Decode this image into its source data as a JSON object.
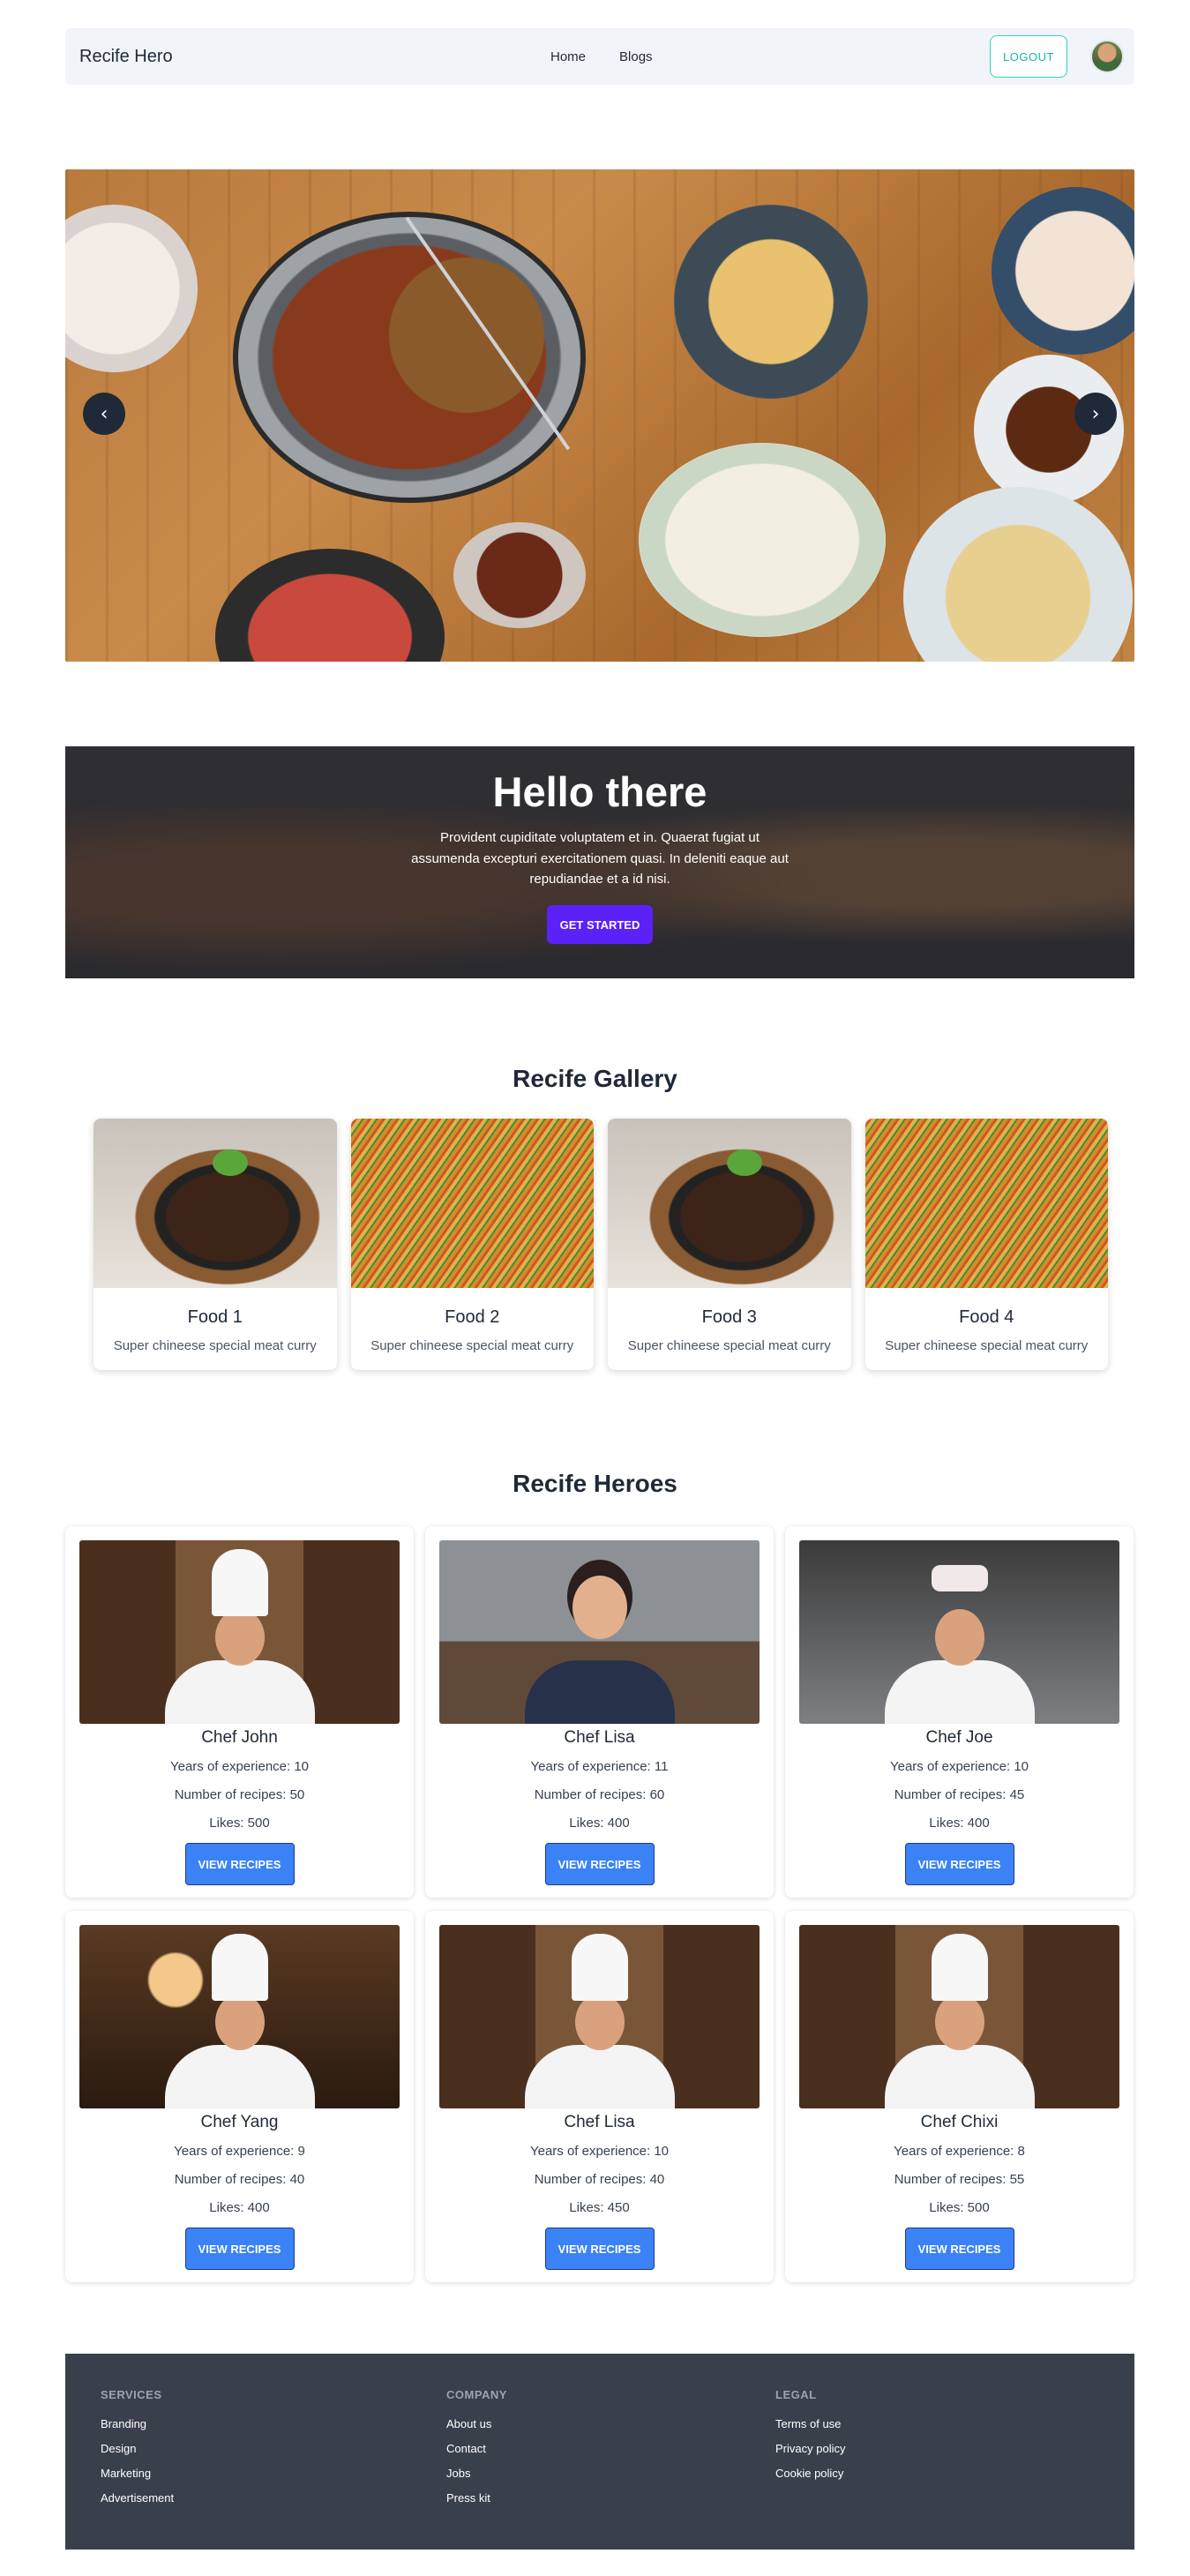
{
  "navbar": {
    "brand": "Recife Hero",
    "links": [
      "Home",
      "Blogs"
    ],
    "logout_label": "LOGOUT"
  },
  "carousel": {
    "prev_icon": "chevron-left-icon",
    "next_icon": "chevron-right-icon"
  },
  "hero": {
    "title": "Hello there",
    "text": "Provident cupiditate voluptatem et in. Quaerat fugiat ut assumenda excepturi exercitationem quasi. In deleniti eaque aut repudiandae et a id nisi.",
    "button_label": "GET STARTED"
  },
  "gallery": {
    "title": "Recife Gallery",
    "items": [
      {
        "name": "Food 1",
        "description": "Super chineese special meat curry"
      },
      {
        "name": "Food 2",
        "description": "Super chineese special meat curry"
      },
      {
        "name": "Food 3",
        "description": "Super chineese special meat curry"
      },
      {
        "name": "Food 4",
        "description": "Super chineese special meat curry"
      }
    ]
  },
  "heroes": {
    "title": "Recife Heroes",
    "button_label": "VIEW RECIPES",
    "chefs": [
      {
        "name": "Chef John",
        "experience": "Years of experience: 10",
        "recipes": "Number of recipes: 50",
        "likes": "Likes: 500"
      },
      {
        "name": "Chef Lisa",
        "experience": "Years of experience: 11",
        "recipes": "Number of recipes: 60",
        "likes": "Likes: 400"
      },
      {
        "name": "Chef Joe",
        "experience": "Years of experience: 10",
        "recipes": "Number of recipes: 45",
        "likes": "Likes: 400"
      },
      {
        "name": "Chef Yang",
        "experience": "Years of experience: 9",
        "recipes": "Number of recipes: 40",
        "likes": "Likes: 400"
      },
      {
        "name": "Chef Lisa",
        "experience": "Years of experience: 10",
        "recipes": "Number of recipes: 40",
        "likes": "Likes: 450"
      },
      {
        "name": "Chef Chixi",
        "experience": "Years of experience: 8",
        "recipes": "Number of recipes: 55",
        "likes": "Likes: 500"
      }
    ]
  },
  "footer": {
    "services": {
      "title": "SERVICES",
      "links": [
        "Branding",
        "Design",
        "Marketing",
        "Advertisement"
      ]
    },
    "company": {
      "title": "COMPANY",
      "links": [
        "About us",
        "Contact",
        "Jobs",
        "Press kit"
      ]
    },
    "legal": {
      "title": "LEGAL",
      "links": [
        "Terms of use",
        "Privacy policy",
        "Cookie policy"
      ]
    }
  }
}
